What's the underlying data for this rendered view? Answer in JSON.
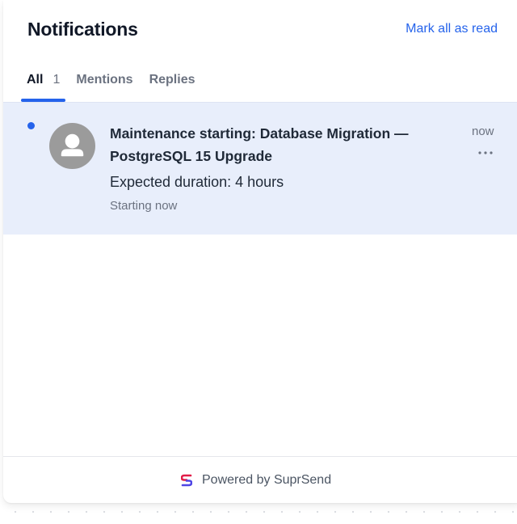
{
  "header": {
    "title": "Notifications",
    "mark_all_label": "Mark all as read"
  },
  "tabs": [
    {
      "label": "All",
      "count": "1",
      "active": true
    },
    {
      "label": "Mentions",
      "active": false
    },
    {
      "label": "Replies",
      "active": false
    }
  ],
  "notifications": [
    {
      "title_line1": "Maintenance starting: Database Migration —",
      "title_line2": "PostgreSQL 15 Upgrade",
      "body": "Expected duration: 4 hours",
      "subtext": "Starting now",
      "time": "now",
      "unread": true,
      "avatar_icon": "user-avatar-icon",
      "more_icon": "more-horizontal-icon"
    }
  ],
  "footer": {
    "powered_by": "Powered by SuprSend",
    "logo_icon": "suprsend-logo-icon"
  },
  "colors": {
    "accent": "#2563eb",
    "unread_background": "#e8eefb",
    "avatar_gray": "#9b9b9b"
  }
}
